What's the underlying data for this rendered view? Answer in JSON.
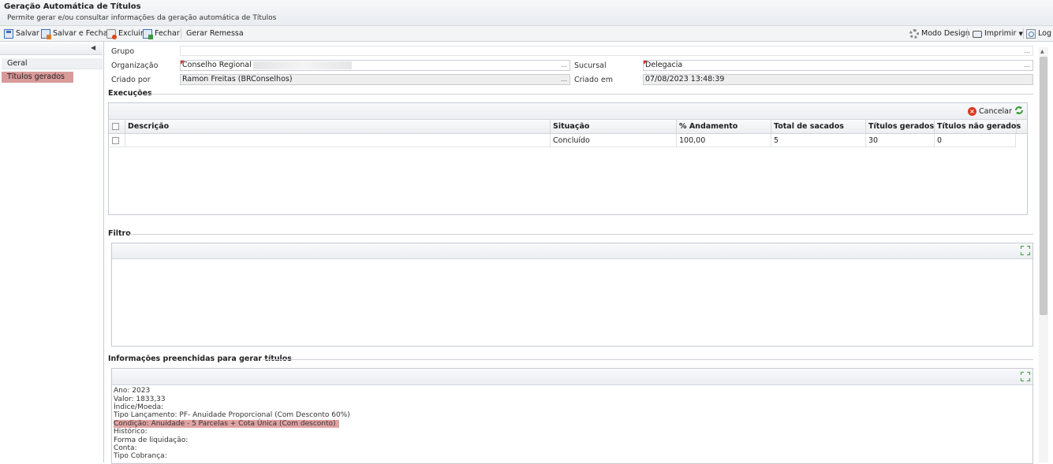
{
  "window": {
    "title": "Geração Automática de Títulos",
    "subtitle": "Permite gerar e/ou consultar informações da geração automática de Títulos"
  },
  "toolbar": {
    "salvar": "Salvar",
    "salvar_fechar": "Salvar e Fechar",
    "excluir": "Excluir",
    "fechar": "Fechar",
    "gerar_remessa": "Gerar Remessa",
    "modo_design": "Modo Design",
    "imprimir": "Imprimir",
    "log": "Log"
  },
  "sidebar": {
    "items": [
      {
        "label": "Geral"
      },
      {
        "label": "Títulos gerados"
      }
    ]
  },
  "form": {
    "grupo_label": "Grupo",
    "organizacao_label": "Organização",
    "organizacao_value": "Conselho Regional",
    "sucursal_label": "Sucursal",
    "sucursal_value": "Delegacia",
    "criado_por_label": "Criado por",
    "criado_por_value": "Ramon Freitas (BRConselhos)",
    "criado_em_label": "Criado em",
    "criado_em_value": "07/08/2023 13:48:39",
    "lookup_dots": "..."
  },
  "execucoes": {
    "section_title": "Execuções",
    "cancelar": "Cancelar",
    "columns": [
      "Descrição",
      "Situação",
      "% Andamento",
      "Total de sacados",
      "Títulos gerados",
      "Títulos não gerados"
    ],
    "rows": [
      {
        "descricao": "",
        "situacao": "Concluído",
        "andamento": "100,00",
        "total_sacados": "5",
        "titulos_gerados": "30",
        "titulos_nao_gerados": "0"
      }
    ]
  },
  "filtro": {
    "section_title": "Filtro"
  },
  "informacoes": {
    "section_title": "Informações preenchidas para gerar títulos",
    "lines": [
      "Ano: 2023",
      "Valor: 1833,33",
      "Índice/Moeda:",
      "Tipo Lançamento: PF- Anuidade Proporcional (Com Desconto 60%)",
      "Condição: Anuidade - 5 Parcelas + Cota Única (Com desconto)",
      "Histórico:",
      "Forma de liquidação:",
      "Conta:",
      "Tipo Cobrança:"
    ],
    "highlighted_line_index": 4
  },
  "colors": {
    "selected_nav": "#d99a9a",
    "highlight": "#e1a3a3",
    "required_marker": "#dd3333",
    "cancel_icon": "#d9381e"
  }
}
